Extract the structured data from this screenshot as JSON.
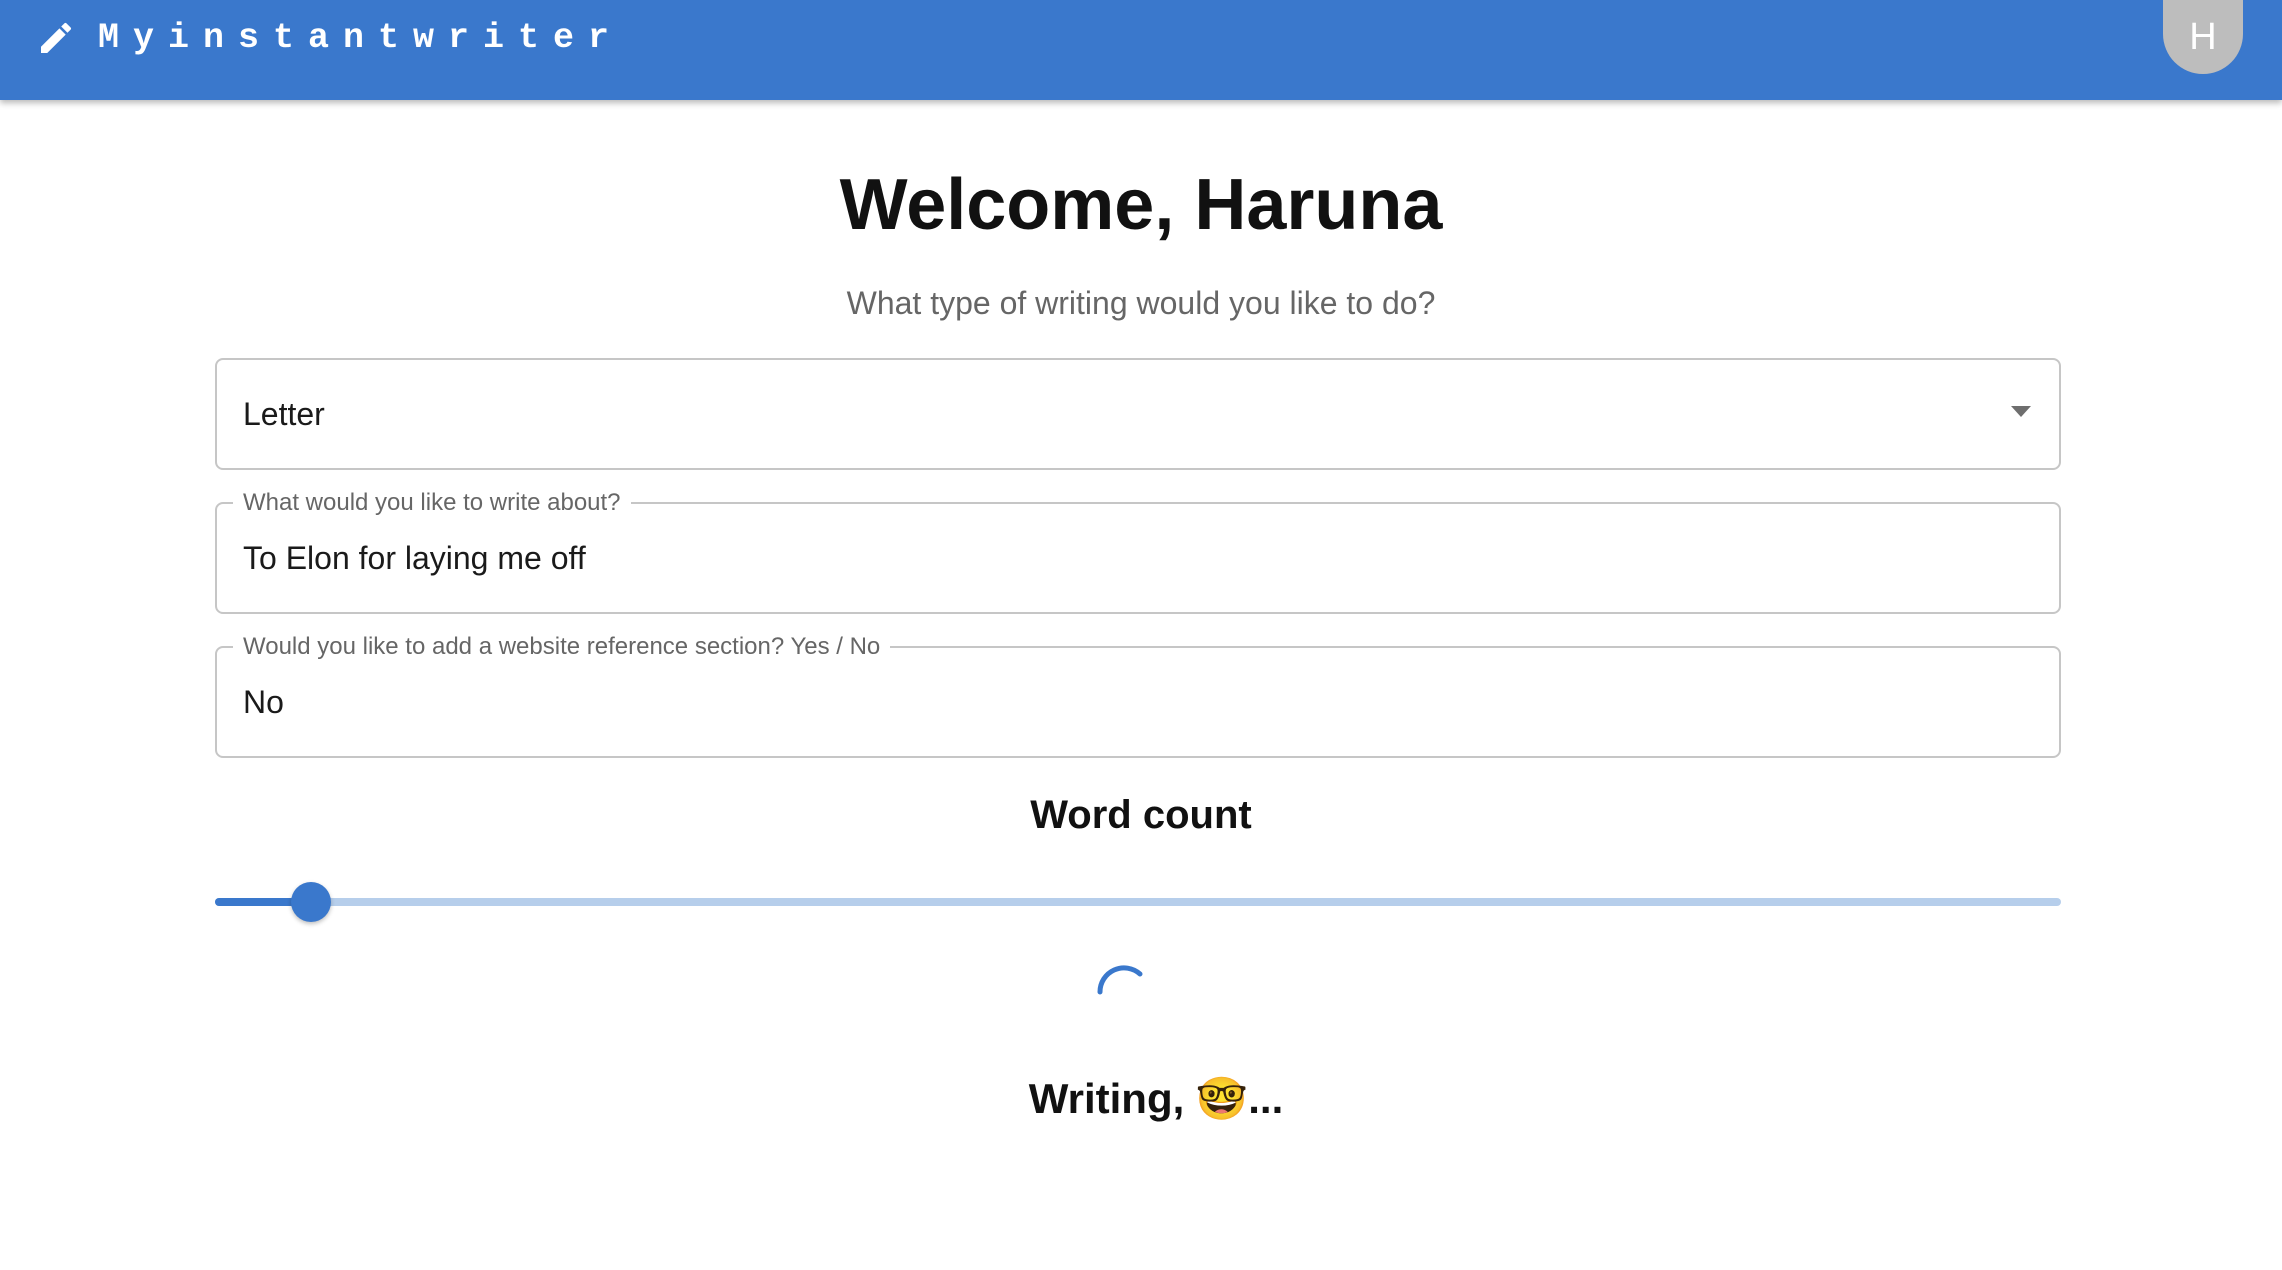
{
  "app": {
    "brand": "Myinstantwriter",
    "brand_icon": "pencil-icon",
    "accent_color": "#3a78cc",
    "avatar_initial": "H"
  },
  "main": {
    "welcome": "Welcome, Haruna",
    "subtitle": "What type of writing would you like to do?"
  },
  "form": {
    "writing_type": {
      "value": "Letter",
      "icon": "arrow-drop-down-icon"
    },
    "topic": {
      "label": "What would you like to write about?",
      "value": "To Elon for laying me off"
    },
    "reference": {
      "label": "Would you like to add a website reference section? Yes / No",
      "value": "No"
    },
    "word_count": {
      "label": "Word count",
      "slider_fraction": 0.052
    }
  },
  "status": {
    "text": "Writing, 🤓...",
    "spinner_icon": "loading-spinner-icon"
  }
}
